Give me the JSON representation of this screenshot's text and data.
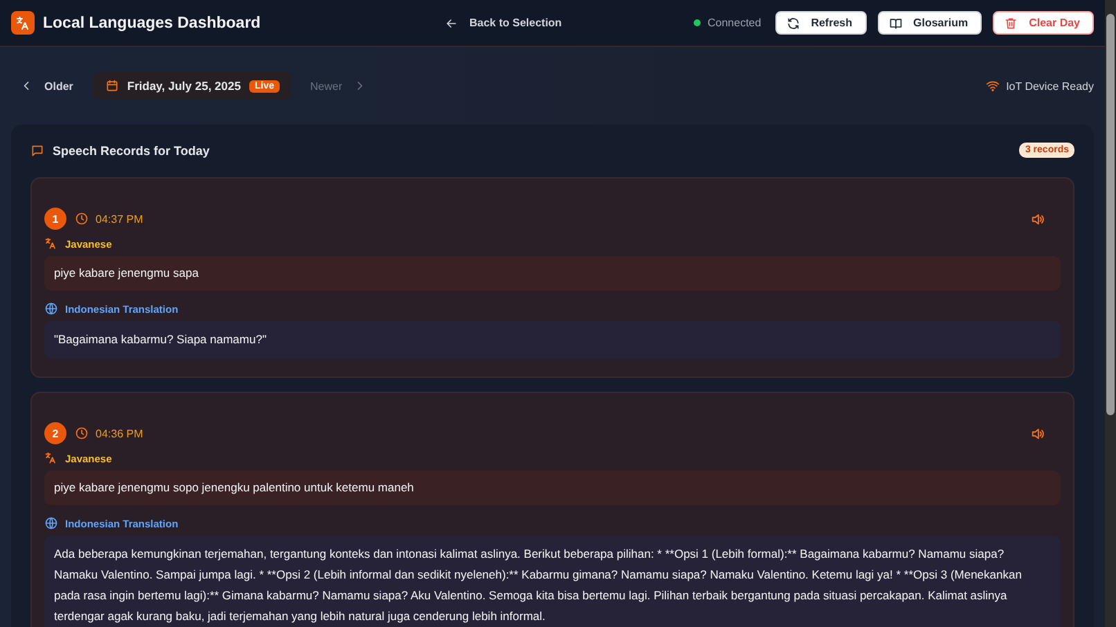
{
  "app": {
    "title": "Local Languages Dashboard"
  },
  "header": {
    "back": "Back to Selection",
    "status": {
      "label": "Connected",
      "color": "#22c55e"
    },
    "buttons": [
      {
        "label": "Refresh",
        "kind": "refresh"
      },
      {
        "label": "Glosarium",
        "kind": "glossary"
      },
      {
        "label": "Clear Day",
        "kind": "danger"
      }
    ]
  },
  "date_nav": {
    "older": "Older",
    "date": "Friday, July 25, 2025",
    "badge": "Live",
    "newer": "Newer",
    "newer_disabled": true,
    "device": "IoT Device Ready"
  },
  "records_panel": {
    "title": "Speech Records for Today",
    "count": "3 records",
    "records": [
      {
        "number": "1",
        "time": "04:37 PM",
        "source_label": "Javanese",
        "source_text": "piye kabare jenengmu sapa",
        "target_label": "Indonesian Translation",
        "target_text": "\"Bagaimana kabarmu? Siapa namamu?\""
      },
      {
        "number": "2",
        "time": "04:36 PM",
        "source_label": "Javanese",
        "source_text": "piye kabare jenengmu sopo jenengku palentino untuk ketemu maneh",
        "target_label": "Indonesian Translation",
        "target_text": "Ada beberapa kemungkinan terjemahan, tergantung konteks dan intonasi kalimat aslinya. Berikut beberapa pilihan: * **Opsi 1 (Lebih formal):** Bagaimana kabarmu? Namamu siapa? Namaku Valentino. Sampai jumpa lagi. * **Opsi 2 (Lebih informal dan sedikit nyeleneh):** Kabarmu gimana? Namamu siapa? Namaku Valentino. Ketemu lagi ya! * **Opsi 3 (Menekankan pada rasa ingin bertemu lagi):** Gimana kabarmu? Namamu siapa? Aku Valentino. Semoga kita bisa bertemu lagi. Pilihan terbaik bergantung pada situasi percakapan. Kalimat aslinya terdengar agak kurang baku, jadi terjemahan yang lebih natural juga cenderung lebih informal."
      }
    ]
  }
}
